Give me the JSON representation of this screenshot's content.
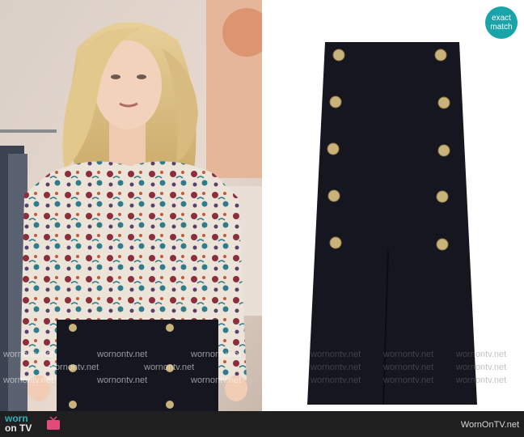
{
  "badge": {
    "line1": "exact",
    "line2": "match"
  },
  "watermark_text": "wornontv.net",
  "footer": {
    "logo_top": "worn",
    "logo_bottom": "on TV",
    "site": "WornOnTV.net"
  },
  "colors": {
    "accent": "#1aa3a8",
    "skirt": "#15161f",
    "button_gold": "#c9b37a",
    "footer_bg": "#1f1f1f"
  }
}
